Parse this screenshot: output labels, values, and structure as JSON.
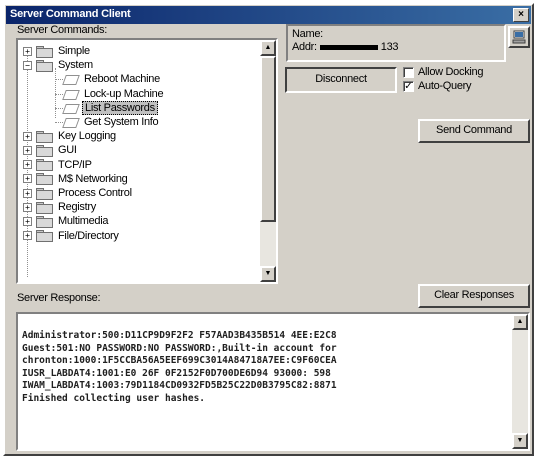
{
  "window": {
    "title": "Server Command Client",
    "close_glyph": "×"
  },
  "commands_label": "Server Commands:",
  "tree": {
    "items": [
      {
        "label": "Simple",
        "expander": "+",
        "type": "folder"
      },
      {
        "label": "System",
        "expander": "−",
        "type": "folder"
      },
      {
        "label": "Reboot Machine",
        "type": "command"
      },
      {
        "label": "Lock-up Machine",
        "type": "command"
      },
      {
        "label": "List Passwords",
        "type": "command",
        "selected": true
      },
      {
        "label": "Get System Info",
        "type": "command"
      },
      {
        "label": "Key Logging",
        "expander": "+",
        "type": "folder"
      },
      {
        "label": "GUI",
        "expander": "+",
        "type": "folder"
      },
      {
        "label": "TCP/IP",
        "expander": "+",
        "type": "folder"
      },
      {
        "label": "M$ Networking",
        "expander": "+",
        "type": "folder"
      },
      {
        "label": "Process Control",
        "expander": "+",
        "type": "folder"
      },
      {
        "label": "Registry",
        "expander": "+",
        "type": "folder"
      },
      {
        "label": "Multimedia",
        "expander": "+",
        "type": "folder"
      },
      {
        "label": "File/Directory",
        "expander": "+",
        "type": "folder"
      }
    ]
  },
  "server": {
    "name_label": "Name:",
    "addr_label": "Addr:",
    "addr_suffix": "133"
  },
  "buttons": {
    "disconnect": "Disconnect",
    "send": "Send Command",
    "clear": "Clear Responses"
  },
  "options": {
    "allow_docking": {
      "label": "Allow Docking",
      "checked": false
    },
    "auto_query": {
      "label": "Auto-Query",
      "checked": true
    }
  },
  "response_label": "Server Response:",
  "response_lines": [
    "Administrator:500:D11CP9D9F2F2 F57AAD3B435B514 4EE:E2C8",
    "Guest:501:NO PASSWORD:NO PASSWORD:,Built-in account for",
    "chronton:1000:1F5CCBA56A5EEF699C3014A84718A7EE:C9F60CEA",
    "IUSR_LABDAT4:1001:E0 26F 0F2152F0D700DE6D94 93000: 598",
    "IWAM_LABDAT4:1003:79D1184CD0932FD5B25C22D0B3795C82:8871",
    "Finished collecting user hashes."
  ],
  "colors": {
    "titlebar_start": "#0a246a",
    "titlebar_end": "#3a6ea5",
    "face": "#d4d0c8"
  }
}
